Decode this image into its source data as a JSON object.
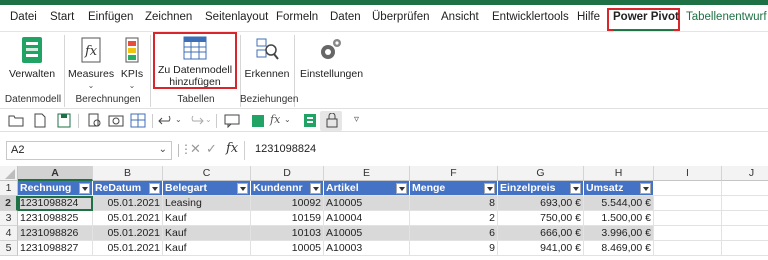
{
  "menu": {
    "items": [
      "Datei",
      "Start",
      "Einfügen",
      "Zeichnen",
      "Seitenlayout",
      "Formeln",
      "Daten",
      "Überprüfen",
      "Ansicht",
      "Entwicklertools",
      "Hilfe",
      "Power Pivot",
      "Tabellenentwurf"
    ]
  },
  "ribbon": {
    "verwalten": "Verwalten",
    "measures": "Measures",
    "kpis": "KPIs",
    "zu_datenmodell": "Zu Datenmodell hinzufügen",
    "erkennen": "Erkennen",
    "einstellungen": "Einstellungen",
    "groups": {
      "datenmodell": "Datenmodell",
      "berechnungen": "Berechnungen",
      "tabellen": "Tabellen",
      "beziehungen": "Beziehungen"
    }
  },
  "formula_bar": {
    "name_box": "A2",
    "fx": "fx",
    "value": "1231098824"
  },
  "sheet": {
    "columns": [
      "A",
      "B",
      "C",
      "D",
      "E",
      "F",
      "G",
      "H",
      "I",
      "J"
    ],
    "rows": [
      "1",
      "2",
      "3",
      "4",
      "5"
    ],
    "headers": [
      "Rechnung",
      "ReDatum",
      "Belegart",
      "Kundennr",
      "Artikel",
      "Menge",
      "Einzelpreis",
      "Umsatz"
    ],
    "data": [
      [
        "1231098824",
        "05.01.2021",
        "Leasing",
        "10092",
        "A10005",
        "8",
        "693,00 €",
        "5.544,00 €"
      ],
      [
        "1231098825",
        "05.01.2021",
        "Kauf",
        "10159",
        "A10004",
        "2",
        "750,00 €",
        "1.500,00 €"
      ],
      [
        "1231098826",
        "05.01.2021",
        "Kauf",
        "10103",
        "A10005",
        "6",
        "666,00 €",
        "3.996,00 €"
      ],
      [
        "1231098827",
        "05.01.2021",
        "Kauf",
        "10005",
        "A10003",
        "9",
        "941,00 €",
        "8.469,00 €"
      ]
    ]
  },
  "colors": {
    "accent": "#1e7145",
    "table_header": "#4472c4",
    "highlight": "#d9262b"
  }
}
